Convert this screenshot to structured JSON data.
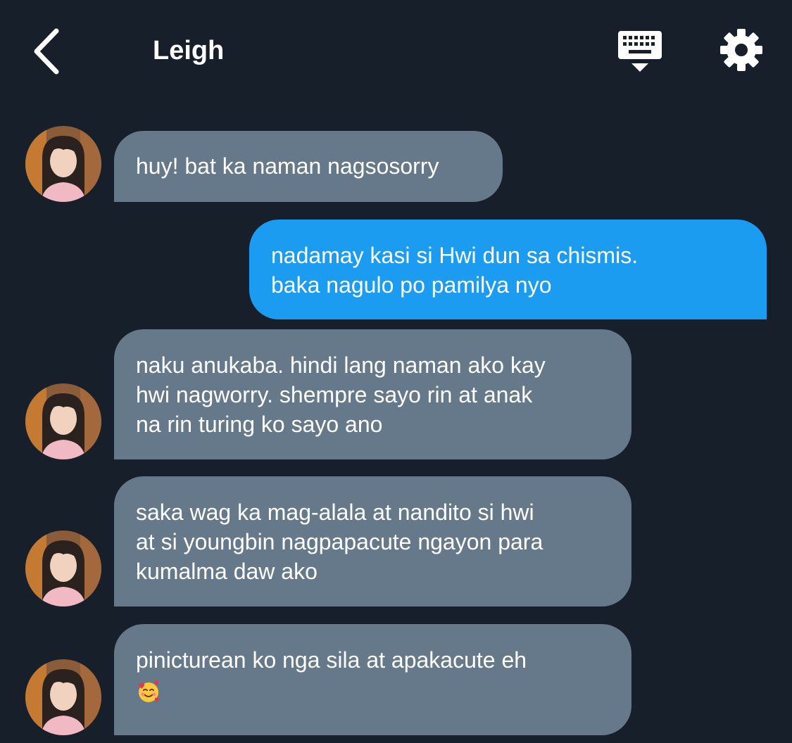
{
  "header": {
    "title": "Leigh",
    "back_icon": "chevron-left-icon",
    "keyboard_icon": "keyboard-icon",
    "settings_icon": "gear-icon"
  },
  "messages": [
    {
      "direction": "received",
      "lines": [
        "huy! bat ka naman nagsosorry"
      ]
    },
    {
      "direction": "sent",
      "lines": [
        "nadamay kasi si Hwi dun sa chismis.",
        "baka nagulo po pamilya nyo"
      ]
    },
    {
      "direction": "received",
      "lines": [
        "naku anukaba. hindi lang naman ako kay",
        "hwi nagworry. shempre sayo rin at anak",
        "na rin turing ko sayo ano"
      ]
    },
    {
      "direction": "received",
      "lines": [
        "saka wag ka mag-alala at nandito si hwi",
        "at si youngbin nagpapacute ngayon para",
        "kumalma daw ako"
      ]
    },
    {
      "direction": "received",
      "lines": [
        "pinicturean ko nga sila at apakacute eh"
      ],
      "emoji": "smiling-face-with-hearts-emoji"
    }
  ],
  "colors": {
    "background": "#17202a",
    "received_bubble": "#66798a",
    "sent_bubble": "#1b9cf0",
    "text": "#ffffff"
  }
}
